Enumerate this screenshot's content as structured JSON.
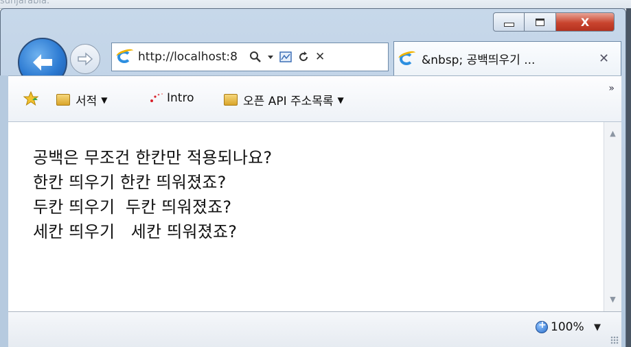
{
  "background_text": "sunjarabia.",
  "window_controls": {
    "close_label": "X"
  },
  "navigation": {
    "back_icon": "arrow-left-icon",
    "forward_icon": "arrow-right-icon"
  },
  "address_bar": {
    "url": "http://localhost:8",
    "search_icon": "magnifier-icon",
    "dropdown_icon": "triangle-down-icon",
    "compat_icon": "compatibility-view-icon",
    "refresh_icon": "refresh-icon",
    "stop_icon": "close-icon"
  },
  "tab": {
    "title": "&nbsp; 공백띄우기 ...",
    "close": "✕"
  },
  "favorites_bar": {
    "items": [
      {
        "label": "서적",
        "type": "folder"
      },
      {
        "label": "Intro",
        "type": "link"
      },
      {
        "label": "오픈 API 주소목록",
        "type": "folder"
      }
    ],
    "more": "»"
  },
  "page": {
    "lines": [
      "공백은 무조건 한칸만 적용되나요?",
      "한칸 띄우기 한칸 띄워졌죠?",
      "두칸 띄우기  두칸 띄워졌죠?",
      "세칸 띄우기   세칸 띄워졌죠?"
    ]
  },
  "status_bar": {
    "zoom": "100%"
  },
  "colors": {
    "accent": "#2c7ad2",
    "close_red": "#c9442e"
  }
}
